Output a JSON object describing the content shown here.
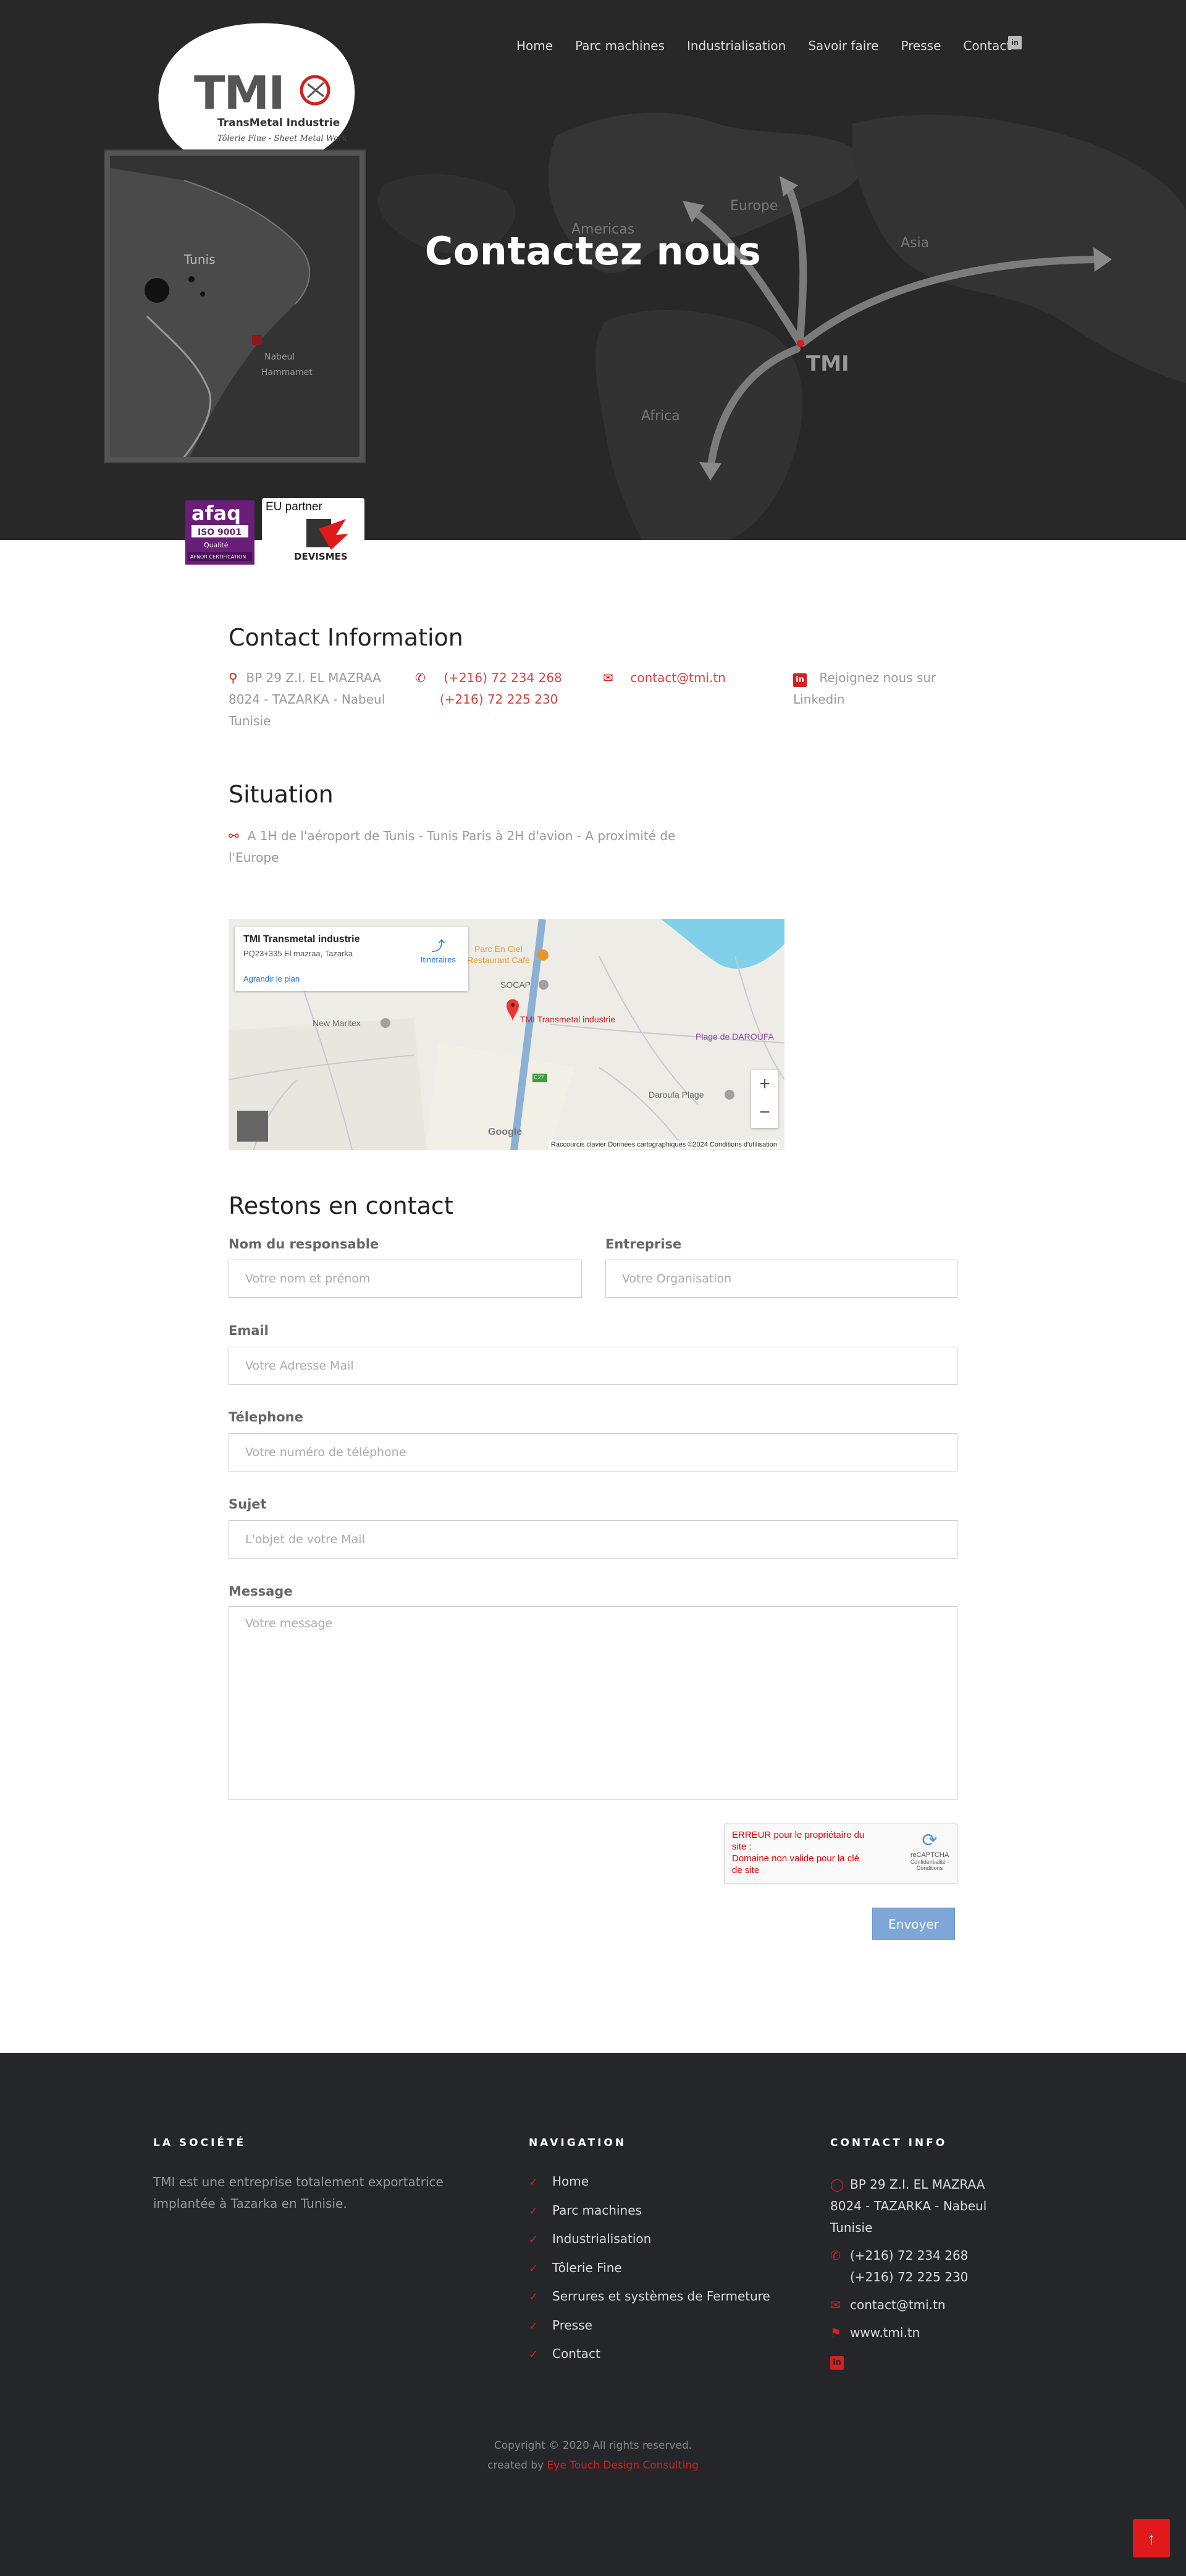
{
  "hero": {
    "title": "Contactez nous"
  },
  "nav": {
    "items": [
      "Home",
      "Parc machines",
      "Industrialisation",
      "Savoir faire",
      "Presse",
      "Contact"
    ],
    "linkedin": "in"
  },
  "logo": {
    "brand": "TMI",
    "name": "TransMetal Industrie",
    "tagline": "Tôlerie Fine - Sheet Metal Work"
  },
  "map_labels": {
    "europe": "Europe",
    "americas": "Americas",
    "asia": "Asia",
    "africa": "Africa",
    "tunis": "Tunis",
    "nabeul": "Nabeul",
    "hammamet": "Hammamet"
  },
  "badges": {
    "afaq": "afaq",
    "iso": "ISO 9001",
    "qualite": "Qualité",
    "afnor": "AFNOR CERTIFICATION",
    "eu_partner": "EU partner",
    "devismes": "DEVISMES"
  },
  "contact_info": {
    "title": "Contact Information",
    "address": "BP 29 Z.I. EL MAZRAA 8024 - TAZARKA - Nabeul Tunisie",
    "phone1": "(+216) 72 234 268",
    "phone2": "(+216) 72 225 230",
    "email": "contact@tmi.tn",
    "linkedin": "Rejoignez nous sur Linkedin"
  },
  "situation": {
    "title": "Situation",
    "text": "A 1H de l'aéroport de Tunis - Tunis Paris à 2H d'avion - A proximité de l'Europe"
  },
  "gmap": {
    "place_name": "TMI Transmetal industrie",
    "address": "PQ23+335 El mazraa, Tazarka",
    "directions": "Itinéraires",
    "enlarge": "Agrandir le plan",
    "marker_label": "TMI Transmetal industrie",
    "poi1": "Parc En Ciel",
    "poi1b": "Restaurant Café",
    "poi2": "SOCAP",
    "poi3": "New Maritex",
    "poi4": "Plage de DAROUFA",
    "poi5": "Daroufa Plage",
    "road": "C27",
    "zoom_in": "+",
    "zoom_out": "−",
    "google": "Google",
    "footer": "Raccourcis clavier   Données cartographiques ©2024   Conditions d'utilisation"
  },
  "form": {
    "title": "Restons en contact",
    "name_label": "Nom du responsable",
    "name_placeholder": "Votre nom et prénom",
    "company_label": "Entreprise",
    "company_placeholder": "Votre Organisation",
    "email_label": "Email",
    "email_placeholder": "Votre Adresse Mail",
    "phone_label": "Télephone",
    "phone_placeholder": "Votre numéro de téléphone",
    "subject_label": "Sujet",
    "subject_placeholder": "L'objet de votre Mail",
    "message_label": "Message",
    "message_placeholder": "Votre message",
    "recaptcha_error": "ERREUR pour le propriétaire du site :",
    "recaptcha_error2": "Domaine non valide pour la clé de site",
    "recaptcha_brand": "reCAPTCHA",
    "recaptcha_links": "Confidentialité - Conditions",
    "submit": "Envoyer"
  },
  "footer": {
    "society_title": "LA SOCIÉTÉ",
    "society_text": "TMI est une entreprise totalement exportatrice implantée à Tazarka en Tunisie.",
    "nav_title": "NAVIGATION",
    "nav_items": [
      "Home",
      "Parc machines",
      "Industrialisation",
      "Tôlerie Fine",
      "Serrures et systèmes de Fermeture",
      "Presse",
      "Contact"
    ],
    "contact_title": "CONTACT INFO",
    "address": "BP 29 Z.I. EL MAZRAA 8024 - TAZARKA - Nabeul Tunisie",
    "phone1": "(+216) 72 234 268",
    "phone2": "(+216) 72 225 230",
    "email": "contact@tmi.tn",
    "website": "www.tmi.tn",
    "linkedin": "in",
    "copyright": "Copyright © 2020 All rights reserved.",
    "created_by": "created by",
    "creator": "Eye Touch Design Consulting"
  },
  "colors": {
    "accent": "#d42020",
    "hero_bg": "#262626",
    "footer_bg": "#25262a",
    "button": "#7ea6d6"
  }
}
